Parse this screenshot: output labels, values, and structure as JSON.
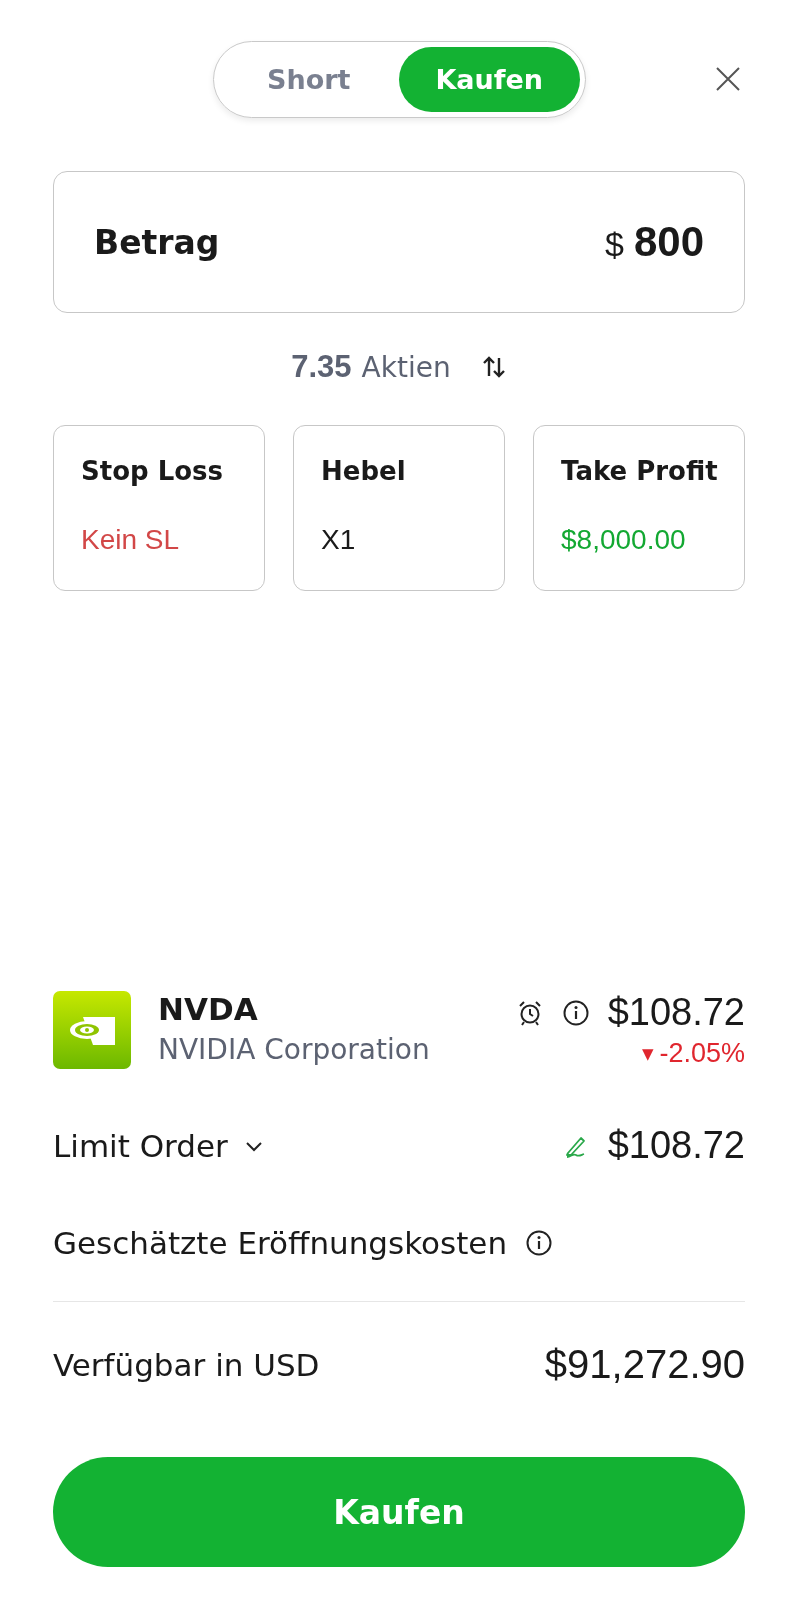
{
  "side_toggle": [
    {
      "label": "Short",
      "selected": false
    },
    {
      "label": "Kaufen",
      "selected": true
    }
  ],
  "amount": {
    "label": "Betrag",
    "currency": "$",
    "value": "800"
  },
  "units": {
    "value": "7.35",
    "label": "Aktien"
  },
  "settings": [
    {
      "label": "Stop Loss",
      "value": "Kein SL",
      "color": "#d24747"
    },
    {
      "label": "Hebel",
      "value": "X1",
      "color": "#1a1a1a"
    },
    {
      "label": "Take Profit",
      "value": "$8,000.00",
      "color": "#13a832"
    }
  ],
  "instrument": {
    "symbol": "NVDA",
    "name": "NVIDIA Corporation",
    "price": "$108.72",
    "change_arrow": "▼",
    "change": "-2.05%"
  },
  "order": {
    "type": "Limit Order",
    "price": "$108.72"
  },
  "cost": {
    "label": "Geschätzte Eröffnungskosten"
  },
  "available": {
    "label": "Verfügbar in USD",
    "value": "$91,272.90"
  },
  "submit": {
    "label": "Kaufen"
  }
}
